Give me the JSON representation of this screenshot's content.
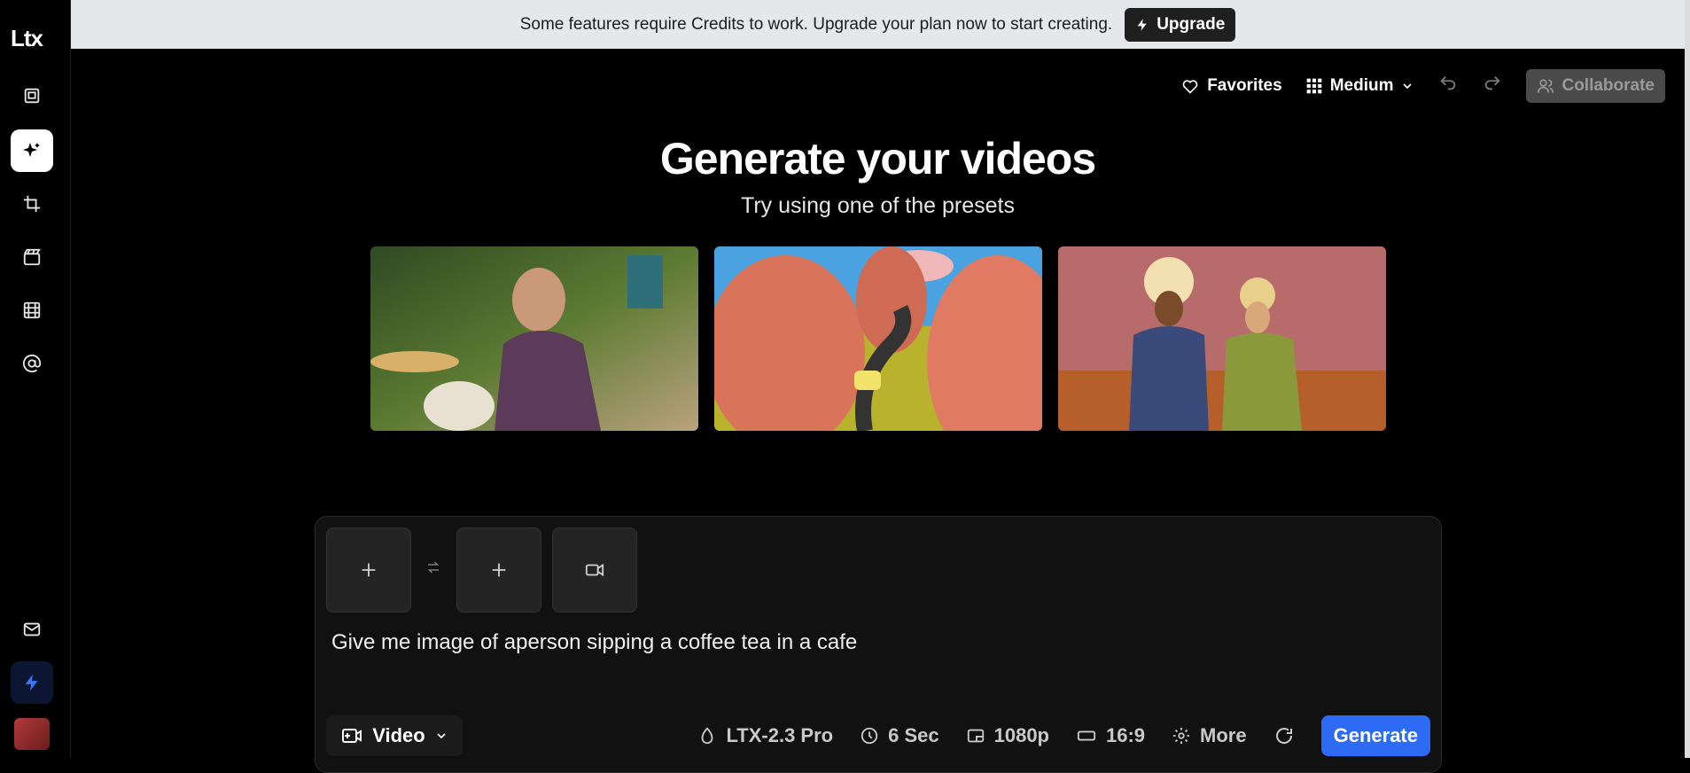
{
  "app": {
    "logo": "Ltx"
  },
  "banner": {
    "message": "Some features require Credits to work. Upgrade your plan now to start creating.",
    "upgrade_label": "Upgrade"
  },
  "toolbar": {
    "favorites_label": "Favorites",
    "size_label": "Medium",
    "collaborate_label": "Collaborate"
  },
  "hero": {
    "title": "Generate your videos",
    "subtitle": "Try using one of the presets"
  },
  "composer": {
    "prompt_value": "Give me image of aperson sipping a coffee tea in a cafe",
    "type_label": "Video",
    "model_label": "LTX-2.3 Pro",
    "duration_label": "6 Sec",
    "resolution_label": "1080p",
    "aspect_label": "16:9",
    "more_label": "More",
    "generate_label": "Generate"
  },
  "colors": {
    "accent": "#2d6bf5",
    "banner_bg": "#e6e7ea",
    "bg": "#000000"
  }
}
